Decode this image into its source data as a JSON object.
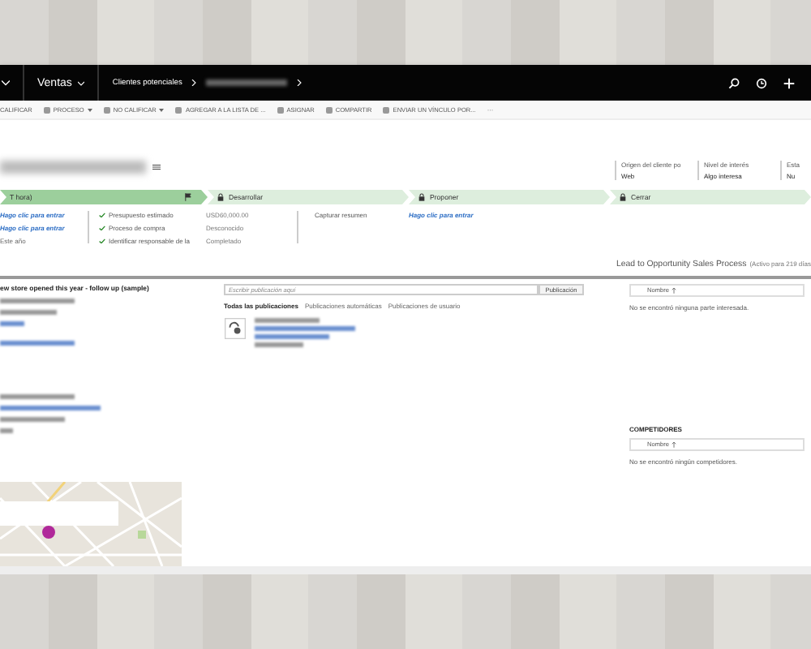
{
  "nav": {
    "area": "Ventas",
    "crumb": "Clientes potenciales"
  },
  "commands": [
    {
      "label": "CALIFICAR",
      "has_menu": false
    },
    {
      "label": "PROCESO",
      "has_menu": true
    },
    {
      "label": "NO CALIFICAR",
      "has_menu": true
    },
    {
      "label": "AGREGAR A LA LISTA DE ...",
      "has_menu": false
    },
    {
      "label": "ASIGNAR",
      "has_menu": false
    },
    {
      "label": "COMPARTIR",
      "has_menu": false
    },
    {
      "label": "ENVIAR UN VÍNCULO POR...",
      "has_menu": false
    },
    {
      "label": "···",
      "has_menu": false
    }
  ],
  "header_fields": [
    {
      "label": "Origen del cliente po",
      "value": "Web"
    },
    {
      "label": "Nivel de interés",
      "value": "Algo interesa"
    },
    {
      "label": "Esta",
      "value": "Nu"
    }
  ],
  "stages": [
    {
      "label": "T hora)",
      "selected": true,
      "locked": false
    },
    {
      "label": "Desarrollar",
      "selected": false,
      "locked": true
    },
    {
      "label": "Proponer",
      "selected": false,
      "locked": true
    },
    {
      "label": "Cerrar",
      "selected": false,
      "locked": true
    }
  ],
  "stage_values": [
    {
      "text": "Hago clic para entrar",
      "kind": "link"
    },
    {
      "text": "Hago clic para entrar",
      "kind": "link"
    },
    {
      "text": "Este año",
      "kind": "plain"
    }
  ],
  "checklist": [
    {
      "label": "Presupuesto estimado",
      "checked": true,
      "value": "USD60,000.00"
    },
    {
      "label": "Proceso de compra",
      "checked": true,
      "value": "Desconocido"
    },
    {
      "label": "Identificar responsable de la",
      "checked": true,
      "value": "Completado"
    }
  ],
  "next_stage_fields": [
    {
      "label": "Capturar resumen",
      "value": "Hago clic para entrar"
    }
  ],
  "process": {
    "name": "Lead to Opportunity Sales Process",
    "status": "(Activo para 219 días"
  },
  "record_title": "ew store opened this year - follow up (sample)",
  "posts": {
    "placeholder": "Escribir publicación aquí",
    "button": "Publicación",
    "tabs": [
      {
        "label": "Todas las publicaciones",
        "selected": true
      },
      {
        "label": "Publicaciones automáticas",
        "selected": false
      },
      {
        "label": "Publicaciones de usuario",
        "selected": false
      }
    ]
  },
  "stakeholders": {
    "column": "Nombre",
    "empty": "No se encontró ninguna parte interesada."
  },
  "competitors": {
    "title": "COMPETIDORES",
    "column": "Nombre",
    "empty": "No se encontró ningún competidores."
  }
}
